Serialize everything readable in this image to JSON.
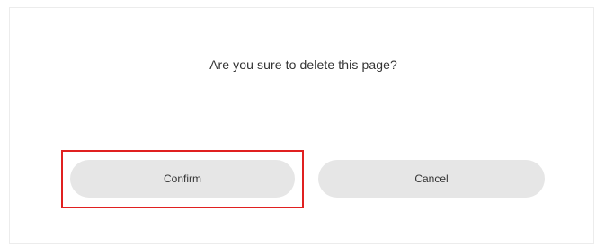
{
  "dialog": {
    "message": "Are you sure to delete this page?",
    "confirm_label": "Confirm",
    "cancel_label": "Cancel"
  },
  "colors": {
    "button_bg": "#e6e6e6",
    "text": "#333333",
    "highlight_border": "#e02020"
  }
}
